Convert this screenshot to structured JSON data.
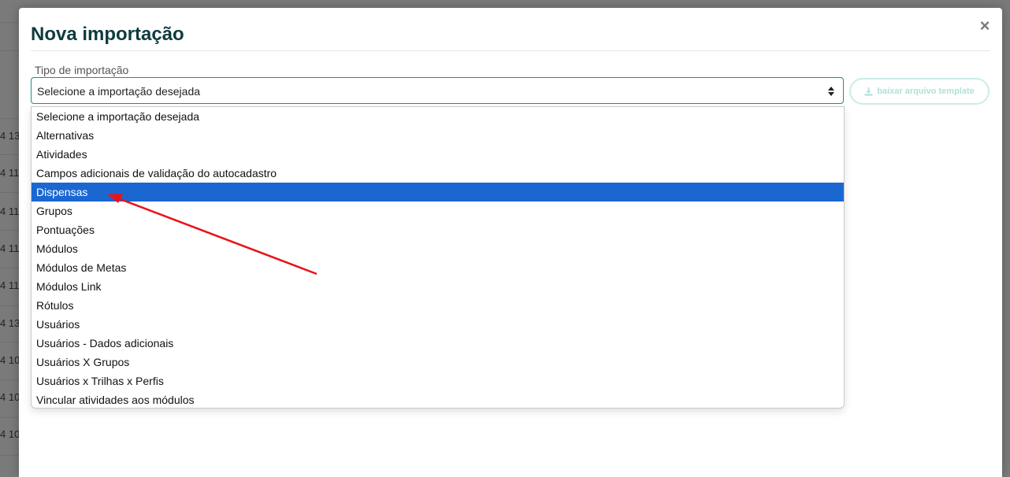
{
  "background": {
    "row_fragments": [
      "4 13",
      "4 11",
      "4 11",
      "4 11",
      "4 11",
      "4 13",
      "4 10",
      "4 10",
      "4 10"
    ]
  },
  "modal": {
    "title": "Nova importação",
    "close_glyph": "×",
    "field_label": "Tipo de importação",
    "select_value": "Selecione a importação desejada",
    "template_button_label": "baixar arquivo template",
    "options": [
      {
        "label": "Selecione a importação desejada",
        "selected": false
      },
      {
        "label": "Alternativas",
        "selected": false
      },
      {
        "label": "Atividades",
        "selected": false
      },
      {
        "label": "Campos adicionais de validação do autocadastro",
        "selected": false
      },
      {
        "label": "Dispensas",
        "selected": true
      },
      {
        "label": "Grupos",
        "selected": false
      },
      {
        "label": "Pontuações",
        "selected": false
      },
      {
        "label": "Módulos",
        "selected": false
      },
      {
        "label": "Módulos de Metas",
        "selected": false
      },
      {
        "label": "Módulos Link",
        "selected": false
      },
      {
        "label": "Rótulos",
        "selected": false
      },
      {
        "label": "Usuários",
        "selected": false
      },
      {
        "label": "Usuários - Dados adicionais",
        "selected": false
      },
      {
        "label": "Usuários X Grupos",
        "selected": false
      },
      {
        "label": "Usuários x Trilhas x Perfis",
        "selected": false
      },
      {
        "label": "Vincular atividades aos módulos",
        "selected": false
      }
    ]
  },
  "icons": {
    "close": "close-icon",
    "select_arrows": "sort-arrows-icon",
    "download": "download-icon"
  },
  "colors": {
    "title": "#0f3b3e",
    "select_border": "#1f8f85",
    "selected_option": "#1a67d2",
    "template_button": "#b3e0d9",
    "annotation_arrow": "#e8141b"
  }
}
